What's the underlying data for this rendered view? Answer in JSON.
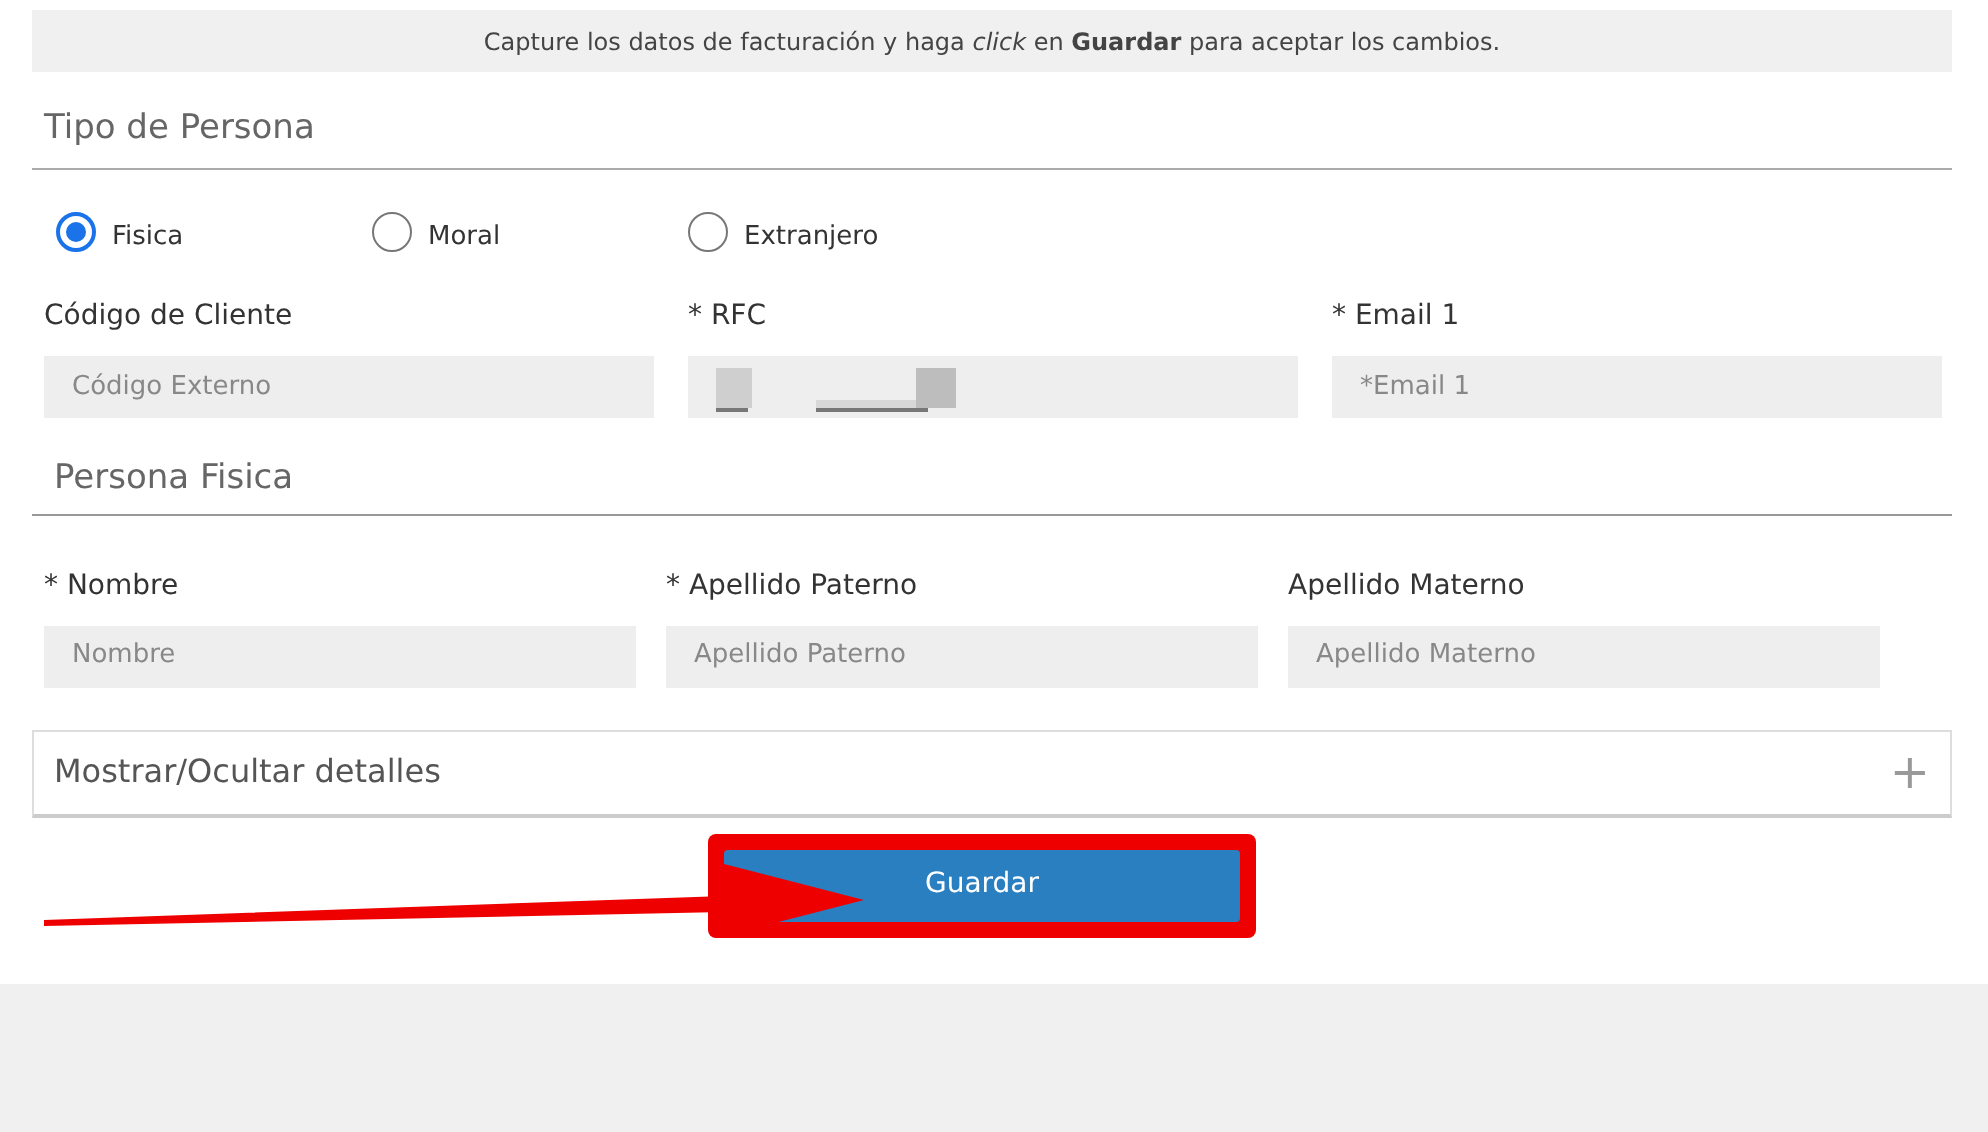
{
  "notice": "Capture los datos de facturación y haga *click* en **Guardar** para aceptar los cambios.",
  "tipo_persona": {
    "title": "Tipo de Persona",
    "options": [
      {
        "label": "Fisica",
        "selected": true
      },
      {
        "label": "Moral",
        "selected": false
      },
      {
        "label": "Extranjero",
        "selected": false
      }
    ]
  },
  "client_fields": [
    {
      "label": "Código de Cliente",
      "placeholder": "Código Externo",
      "kind": "input"
    },
    {
      "label": "* RFC",
      "kind": "redacted"
    },
    {
      "label": "* Email 1",
      "placeholder": "*Email 1",
      "kind": "input"
    }
  ],
  "persona_fisica": {
    "title": "Persona Fisica",
    "fields": [
      {
        "label": "* Nombre",
        "placeholder": "Nombre"
      },
      {
        "label": "* Apellido Paterno",
        "placeholder": "Apellido Paterno"
      },
      {
        "label": "Apellido Materno",
        "placeholder": "Apellido Materno"
      }
    ]
  },
  "details": {
    "label": "Mostrar/Ocultar detalles",
    "expanded": false,
    "toggle": "+"
  },
  "save_button": {
    "label": "Guardar",
    "highlighted": true
  }
}
